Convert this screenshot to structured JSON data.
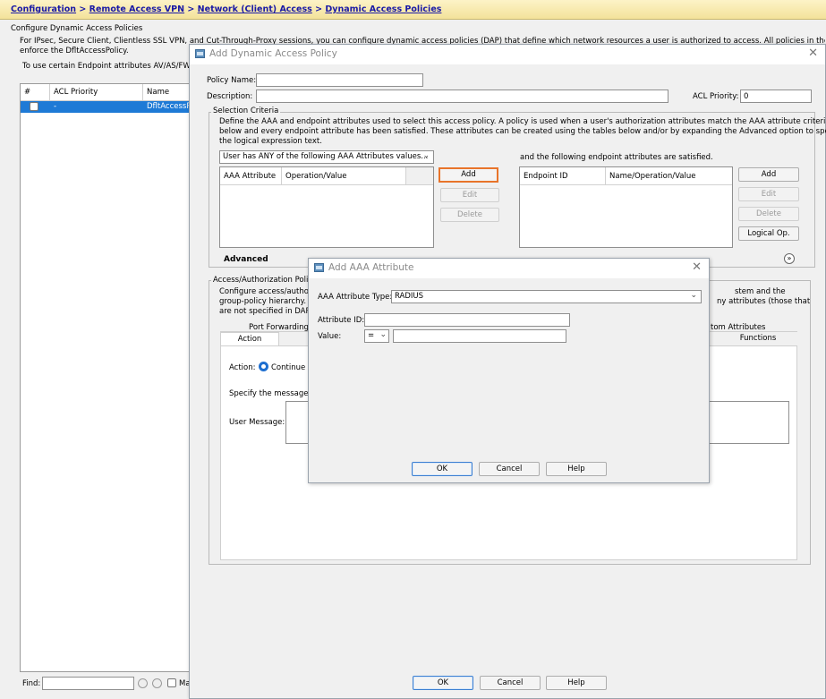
{
  "breadcrumb": {
    "items": [
      "Configuration",
      "Remote Access VPN",
      "Network (Client) Access",
      "Dynamic Access Policies"
    ],
    "sep": ">"
  },
  "main": {
    "group_title": "Configure Dynamic Access Policies",
    "intro_line1": "For IPsec, Secure Client, Clientless SSL VPN, and Cut-Through-Proxy sessions, you can configure dynamic access policies (DAP) that define which network resources a user is authorized to access. All policies in the table below are",
    "intro_line2": "enforce the DfltAccessPolicy.",
    "intro_line3": "To use certain Endpoint attributes AV/AS/FW o",
    "table": {
      "columns": [
        "#",
        "ACL Priority",
        "Name"
      ],
      "rows": [
        {
          "num": "",
          "priority": "-",
          "name": "DfltAccessPolicy"
        }
      ]
    },
    "find_label": "Find:",
    "find_value": "",
    "match_case_label": "Ma"
  },
  "dap_dialog": {
    "title": "Add Dynamic Access Policy",
    "policy_name_label": "Policy Name:",
    "policy_name_value": "",
    "description_label": "Description:",
    "description_value": "",
    "acl_priority_label": "ACL Priority:",
    "acl_priority_value": "0",
    "selection_criteria": {
      "title": "Selection Criteria",
      "desc1": "Define the AAA and endpoint attributes used to select this access policy. A policy is used when a user's authorization attributes match the AAA attribute criteria",
      "desc2": "below and every endpoint attribute has been satisfied. These attributes can be created using the tables below and/or by expanding the Advanced option to specify",
      "desc3": "the logical expression text.",
      "aaa_match_select": "User has ANY of the following AAA Attributes values...",
      "endpoint_caption": "and the following endpoint attributes are satisfied.",
      "aaa_columns": [
        "AAA Attribute",
        "Operation/Value"
      ],
      "endpoint_columns": [
        "Endpoint ID",
        "Name/Operation/Value"
      ],
      "aaa_buttons": {
        "add": "Add",
        "edit": "Edit",
        "delete": "Delete"
      },
      "endpoint_buttons": {
        "add": "Add",
        "edit": "Edit",
        "delete": "Delete",
        "logical": "Logical Op."
      },
      "advanced_label": "Advanced"
    },
    "access_policy": {
      "title": "Access/Authorization Policy",
      "desc1_left": "Configure access/authoriz",
      "desc1_right": "stem and the",
      "desc2_left": "group-policy hierarchy. T",
      "desc2_right": "ny attributes (those that",
      "desc3_left": "are not specified in DAP).",
      "tabs_row1_left": "Port Forwarding",
      "tabs_row1_right": "tom Attributes",
      "tab_action": "Action",
      "tab_functions": "Functions",
      "action_label": "Action:",
      "action_value": "Continue",
      "message_label": "Specify the message th",
      "user_message_label": "User Message:",
      "user_message_value": ""
    },
    "buttons": {
      "ok": "OK",
      "cancel": "Cancel",
      "help": "Help"
    }
  },
  "aaa_dialog": {
    "title": "Add AAA Attribute",
    "type_label": "AAA Attribute Type:",
    "type_value": "RADIUS",
    "attr_id_label": "Attribute ID:",
    "attr_id_value": "",
    "value_label": "Value:",
    "operator_value": "=",
    "value_value": "",
    "buttons": {
      "ok": "OK",
      "cancel": "Cancel",
      "help": "Help"
    }
  },
  "colors": {
    "breadcrumb_link": "#1a1aa6",
    "selected_row": "#1e7ad6",
    "highlight_box": "#e8742a",
    "default_button_border": "#3c7fd1"
  }
}
